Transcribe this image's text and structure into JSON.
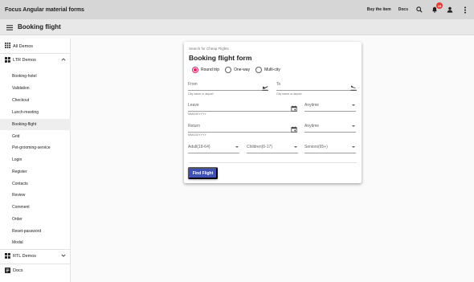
{
  "app": {
    "title": "Focus Angular material forms",
    "buy_label": "Buy the item",
    "docs_label": "Docs",
    "notification_count": "15"
  },
  "header": {
    "title": "Booking flight"
  },
  "sidebar": {
    "all_demos": "All Demos",
    "ltr": "LTR Demos",
    "items": [
      {
        "label": "Booking-hotel"
      },
      {
        "label": "Validation"
      },
      {
        "label": "Checkout"
      },
      {
        "label": "Lunch-meeting"
      },
      {
        "label": "Booking-flight"
      },
      {
        "label": "Grid"
      },
      {
        "label": "Pet-grooming-service"
      },
      {
        "label": "Login"
      },
      {
        "label": "Register"
      },
      {
        "label": "Contacts"
      },
      {
        "label": "Review"
      },
      {
        "label": "Comment"
      },
      {
        "label": "Order"
      },
      {
        "label": "Reset-password"
      },
      {
        "label": "Modal"
      }
    ],
    "rtl": "RTL Demos",
    "docs": "Docs"
  },
  "form": {
    "subtitle": "Search for Cheap Flights",
    "title": "Booking flight form",
    "trip_types": [
      "Round trip",
      "One-way",
      "Multi-city"
    ],
    "selected_trip": "Round trip",
    "from_label": "From",
    "from_hint": "City name or airport",
    "to_label": "To",
    "to_hint": "City name or airport",
    "leave_label": "Leave",
    "leave_hint": "MM/DD/YYYY",
    "leave_time": "Anytime",
    "return_label": "Return",
    "return_hint": "MM/DD/YYYY",
    "return_time": "Anytime",
    "adult": "Adult(18-64)",
    "children": "Children(0-17)",
    "seniors": "Seniors(65+)",
    "submit_label": "Find Flight"
  },
  "colors": {
    "accent": "#3f51b5",
    "radio_selected": "#e91e63",
    "badge": "#e53935",
    "toolbar": "#d6d6d6"
  }
}
